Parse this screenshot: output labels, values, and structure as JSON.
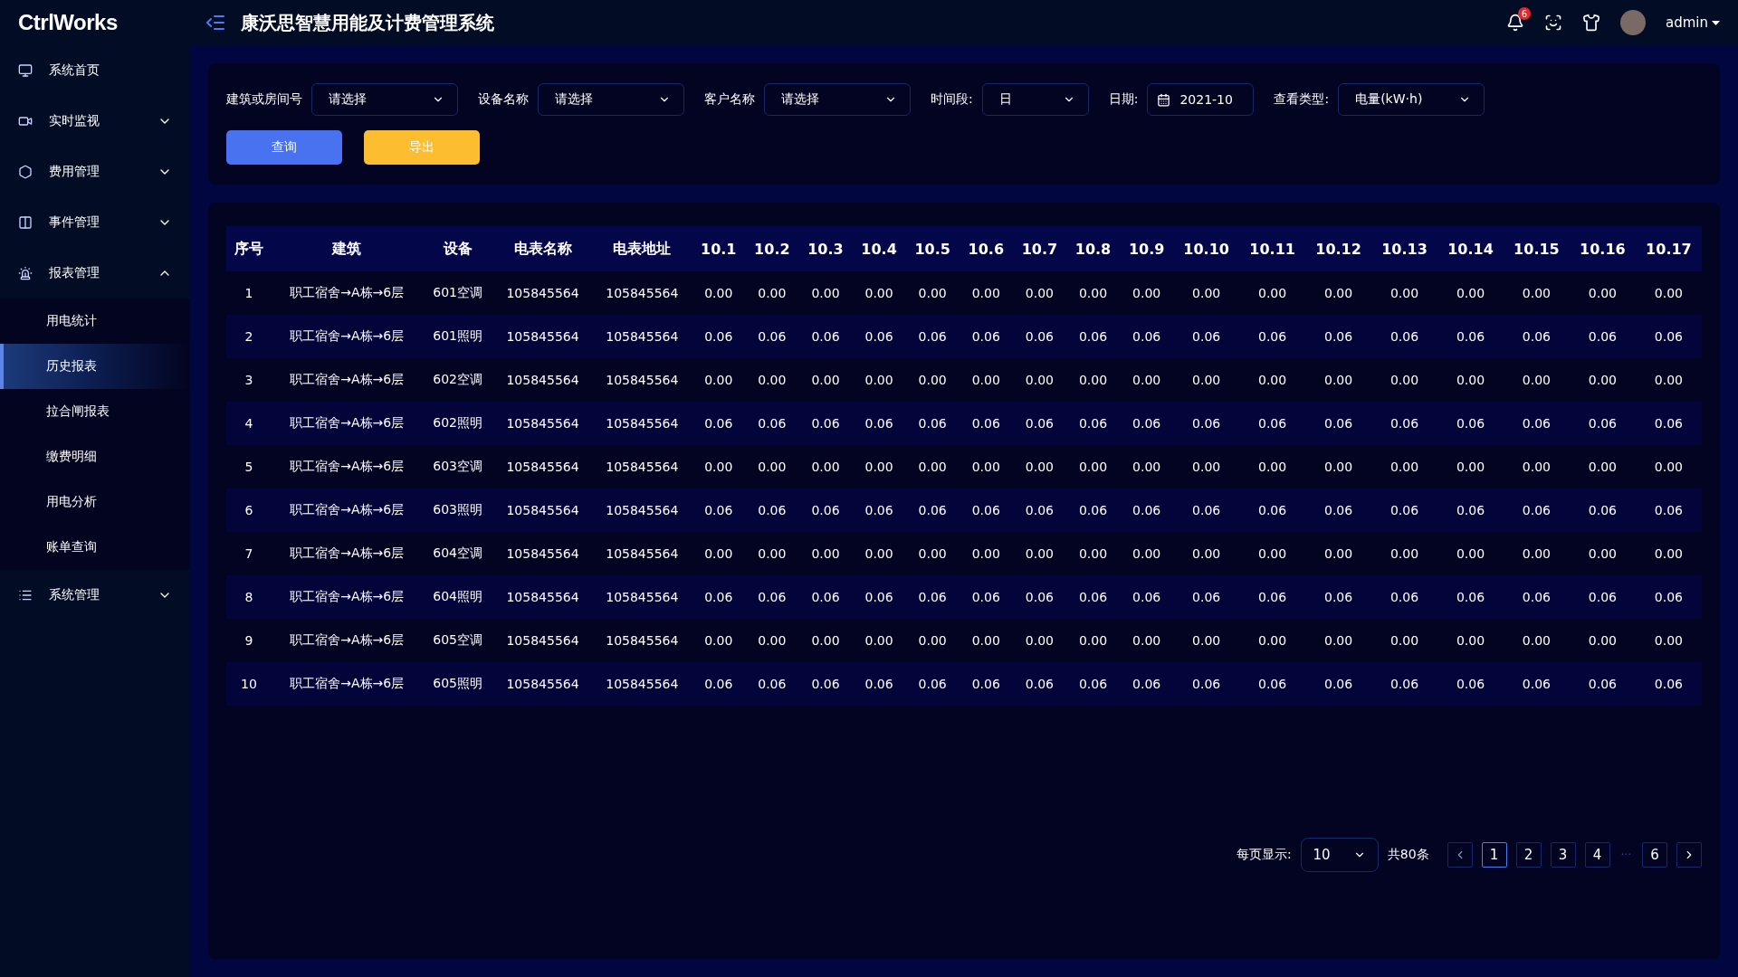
{
  "app": {
    "logo": "CtrlWorks",
    "title": "康沃思智慧用能及计费管理系统",
    "notifications": "6",
    "user": "admin"
  },
  "sidebar": {
    "items": [
      {
        "label": "系统首页"
      },
      {
        "label": "实时监视",
        "expanded": false
      },
      {
        "label": "费用管理",
        "expanded": false
      },
      {
        "label": "事件管理",
        "expanded": false
      },
      {
        "label": "报表管理",
        "expanded": true,
        "children": [
          {
            "label": "用电统计",
            "selected": false
          },
          {
            "label": "历史报表",
            "selected": true
          },
          {
            "label": "拉合闸报表",
            "selected": false
          },
          {
            "label": "缴费明细",
            "selected": false
          },
          {
            "label": "用电分析",
            "selected": false
          },
          {
            "label": "账单查询",
            "selected": false
          }
        ]
      },
      {
        "label": "系统管理",
        "expanded": false
      }
    ]
  },
  "filters": [
    {
      "kind": "select",
      "label": "建筑或房间号",
      "placeholder": "请选择"
    },
    {
      "kind": "select",
      "label": "设备名称",
      "placeholder": "请选择"
    },
    {
      "kind": "select",
      "label": "客户名称",
      "placeholder": "请选择"
    },
    {
      "kind": "select",
      "label": "时间段:",
      "value": "日"
    },
    {
      "kind": "date",
      "label": "日期:",
      "value": "2021-10"
    },
    {
      "kind": "select",
      "label": "查看类型:",
      "value": "电量(kW·h)"
    }
  ],
  "buttons": [
    {
      "label": "查询",
      "kind": "primary"
    },
    {
      "label": "导出",
      "kind": "warning"
    }
  ],
  "table": {
    "columns": [
      "序号",
      "建筑",
      "设备",
      "电表名称",
      "电表地址",
      "10.1",
      "10.2",
      "10.3",
      "10.4",
      "10.5",
      "10.6",
      "10.7",
      "10.8",
      "10.9",
      "10.10",
      "10.11",
      "10.12",
      "10.13",
      "10.14",
      "10.15",
      "10.16",
      "10.17"
    ],
    "rows": [
      [
        "1",
        "职工宿舍→A栋→6层",
        "601空调",
        "105845564",
        "105845564",
        "0.00",
        "0.00",
        "0.00",
        "0.00",
        "0.00",
        "0.00",
        "0.00",
        "0.00",
        "0.00",
        "0.00",
        "0.00",
        "0.00",
        "0.00",
        "0.00",
        "0.00",
        "0.00",
        "0.00"
      ],
      [
        "2",
        "职工宿舍→A栋→6层",
        "601照明",
        "105845564",
        "105845564",
        "0.06",
        "0.06",
        "0.06",
        "0.06",
        "0.06",
        "0.06",
        "0.06",
        "0.06",
        "0.06",
        "0.06",
        "0.06",
        "0.06",
        "0.06",
        "0.06",
        "0.06",
        "0.06",
        "0.06"
      ],
      [
        "3",
        "职工宿舍→A栋→6层",
        "602空调",
        "105845564",
        "105845564",
        "0.00",
        "0.00",
        "0.00",
        "0.00",
        "0.00",
        "0.00",
        "0.00",
        "0.00",
        "0.00",
        "0.00",
        "0.00",
        "0.00",
        "0.00",
        "0.00",
        "0.00",
        "0.00",
        "0.00"
      ],
      [
        "4",
        "职工宿舍→A栋→6层",
        "602照明",
        "105845564",
        "105845564",
        "0.06",
        "0.06",
        "0.06",
        "0.06",
        "0.06",
        "0.06",
        "0.06",
        "0.06",
        "0.06",
        "0.06",
        "0.06",
        "0.06",
        "0.06",
        "0.06",
        "0.06",
        "0.06",
        "0.06"
      ],
      [
        "5",
        "职工宿舍→A栋→6层",
        "603空调",
        "105845564",
        "105845564",
        "0.00",
        "0.00",
        "0.00",
        "0.00",
        "0.00",
        "0.00",
        "0.00",
        "0.00",
        "0.00",
        "0.00",
        "0.00",
        "0.00",
        "0.00",
        "0.00",
        "0.00",
        "0.00",
        "0.00"
      ],
      [
        "6",
        "职工宿舍→A栋→6层",
        "603照明",
        "105845564",
        "105845564",
        "0.06",
        "0.06",
        "0.06",
        "0.06",
        "0.06",
        "0.06",
        "0.06",
        "0.06",
        "0.06",
        "0.06",
        "0.06",
        "0.06",
        "0.06",
        "0.06",
        "0.06",
        "0.06",
        "0.06"
      ],
      [
        "7",
        "职工宿舍→A栋→6层",
        "604空调",
        "105845564",
        "105845564",
        "0.00",
        "0.00",
        "0.00",
        "0.00",
        "0.00",
        "0.00",
        "0.00",
        "0.00",
        "0.00",
        "0.00",
        "0.00",
        "0.00",
        "0.00",
        "0.00",
        "0.00",
        "0.00",
        "0.00"
      ],
      [
        "8",
        "职工宿舍→A栋→6层",
        "604照明",
        "105845564",
        "105845564",
        "0.06",
        "0.06",
        "0.06",
        "0.06",
        "0.06",
        "0.06",
        "0.06",
        "0.06",
        "0.06",
        "0.06",
        "0.06",
        "0.06",
        "0.06",
        "0.06",
        "0.06",
        "0.06",
        "0.06"
      ],
      [
        "9",
        "职工宿舍→A栋→6层",
        "605空调",
        "105845564",
        "105845564",
        "0.00",
        "0.00",
        "0.00",
        "0.00",
        "0.00",
        "0.00",
        "0.00",
        "0.00",
        "0.00",
        "0.00",
        "0.00",
        "0.00",
        "0.00",
        "0.00",
        "0.00",
        "0.00",
        "0.00"
      ],
      [
        "10",
        "职工宿舍→A栋→6层",
        "605照明",
        "105845564",
        "105845564",
        "0.06",
        "0.06",
        "0.06",
        "0.06",
        "0.06",
        "0.06",
        "0.06",
        "0.06",
        "0.06",
        "0.06",
        "0.06",
        "0.06",
        "0.06",
        "0.06",
        "0.06",
        "0.06",
        "0.06"
      ]
    ]
  },
  "pagination": {
    "page_size_label": "每页显示:",
    "page_size": "10",
    "total": "共80条",
    "pages": [
      {
        "kind": "prev"
      },
      {
        "kind": "page",
        "label": "1",
        "selected": true
      },
      {
        "kind": "page",
        "label": "2",
        "selected": false
      },
      {
        "kind": "page",
        "label": "3",
        "selected": false
      },
      {
        "kind": "page",
        "label": "4",
        "selected": false
      },
      {
        "kind": "ellipsis",
        "label": "···"
      },
      {
        "kind": "page",
        "label": "6",
        "selected": false
      },
      {
        "kind": "next"
      }
    ]
  }
}
